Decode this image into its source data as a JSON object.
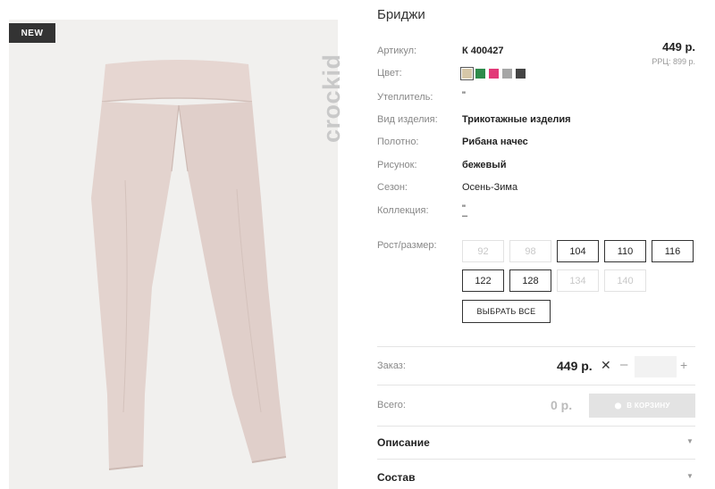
{
  "product": {
    "badge": "NEW",
    "brand": "crockid",
    "title": "Бриджи",
    "price": "449 р.",
    "rrp": "РРЦ: 899 р."
  },
  "attributes": [
    {
      "label": "Артикул:",
      "value": "К 400427",
      "bold": true
    },
    {
      "label": "Цвет:",
      "value": "",
      "bold": false
    },
    {
      "label": "Утеплитель:",
      "value": "\"",
      "bold": false
    },
    {
      "label": "Вид изделия:",
      "value": "Трикотажные изделия",
      "bold": true
    },
    {
      "label": "Полотно:",
      "value": "Рибана начес",
      "bold": true
    },
    {
      "label": "Рисунок:",
      "value": "бежевый",
      "bold": true
    },
    {
      "label": "Сезон:",
      "value": "Осень-Зима",
      "bold": false
    },
    {
      "label": "Коллекция:",
      "value": "\"",
      "value2": "–",
      "bold": false
    }
  ],
  "colors": [
    {
      "name": "beige",
      "hex": "#d6c7a8",
      "selected": true
    },
    {
      "name": "green",
      "hex": "#2e8b4b",
      "selected": false
    },
    {
      "name": "pink",
      "hex": "#e23a78",
      "selected": false
    },
    {
      "name": "grey",
      "hex": "#a6a6a6",
      "selected": false
    },
    {
      "name": "dark-grey",
      "hex": "#444444",
      "selected": false
    }
  ],
  "sizes": {
    "label": "Рост/размер:",
    "items": [
      {
        "value": "92",
        "available": false
      },
      {
        "value": "98",
        "available": false
      },
      {
        "value": "104",
        "available": true
      },
      {
        "value": "110",
        "available": true
      },
      {
        "value": "116",
        "available": true
      },
      {
        "value": "122",
        "available": true
      },
      {
        "value": "128",
        "available": true
      },
      {
        "value": "134",
        "available": false
      },
      {
        "value": "140",
        "available": false
      }
    ],
    "select_all": "ВЫБРАТЬ ВСЕ"
  },
  "order": {
    "label": "Заказ:",
    "price": "449 р.",
    "times": "✕",
    "minus": "–",
    "plus": "+",
    "quantity": ""
  },
  "total": {
    "label": "Всего:",
    "value": "0 р.",
    "cart_button": "В КОРЗИНУ"
  },
  "accordion": [
    {
      "label": "Описание"
    },
    {
      "label": "Состав"
    }
  ],
  "ui": {
    "accent": "#333333",
    "photo_bg": "#f1f0ee",
    "garment_color": "#e3d3ce"
  }
}
